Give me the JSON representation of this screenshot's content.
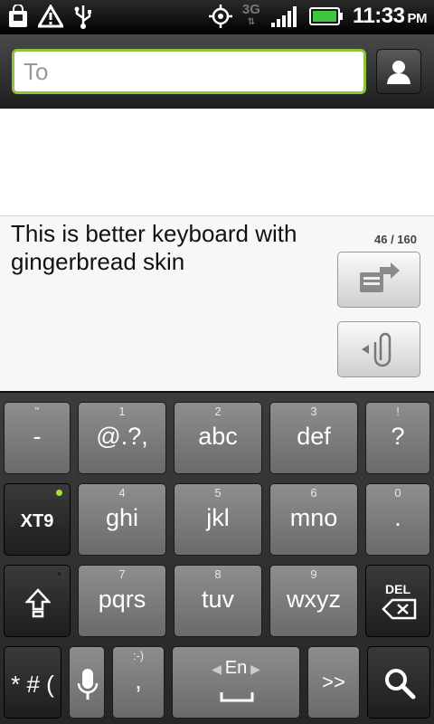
{
  "status_bar": {
    "network": "3G",
    "time": "11:33",
    "ampm": "PM",
    "icons": [
      "shopping-bag-icon",
      "warning-icon",
      "usb-icon",
      "gps-icon",
      "data-arrows-icon",
      "signal-icon",
      "battery-icon"
    ],
    "battery_color": "#3fc63f"
  },
  "header": {
    "to_placeholder": "To",
    "contact_icon": "person-icon"
  },
  "compose": {
    "text": "This is better keyboard with gingerbread skin",
    "counter": "46 / 160",
    "send_icon": "send-icon",
    "attach_icon": "paperclip-icon"
  },
  "keyboard": {
    "row1": [
      {
        "sub": "\"",
        "main": "-"
      },
      {
        "sub": "1",
        "main": "@.?,"
      },
      {
        "sub": "2",
        "main": "abc"
      },
      {
        "sub": "3",
        "main": "def"
      },
      {
        "sub": "!",
        "main": "?"
      }
    ],
    "row2": [
      {
        "sub": "",
        "main": "XT9"
      },
      {
        "sub": "4",
        "main": "ghi"
      },
      {
        "sub": "5",
        "main": "jkl"
      },
      {
        "sub": "6",
        "main": "mno"
      },
      {
        "sub": "0",
        "main": "."
      }
    ],
    "row3": [
      {
        "sub": "",
        "main": "shift"
      },
      {
        "sub": "7",
        "main": "pqrs"
      },
      {
        "sub": "8",
        "main": "tuv"
      },
      {
        "sub": "9",
        "main": "wxyz"
      },
      {
        "sub": "DEL",
        "main": "backspace"
      }
    ],
    "row4": {
      "symbols": "* # (",
      "mic": "mic-icon",
      "smiley_sub": ":-)",
      "smiley_main": ",",
      "lang": "En",
      "next": ">>",
      "search": "search-icon"
    },
    "xt9_indicator_color": "#a6e22e"
  }
}
